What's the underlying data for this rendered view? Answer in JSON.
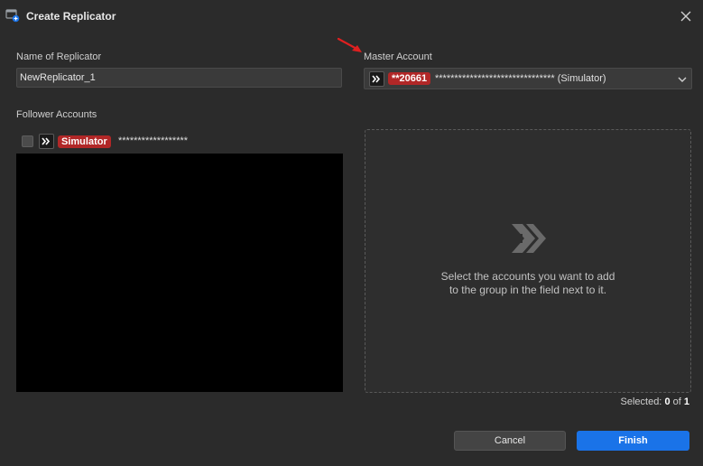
{
  "dialog": {
    "title": "Create Replicator",
    "close_icon": "close-icon",
    "app_icon": "replicator-app-icon"
  },
  "name_field": {
    "label": "Name of Replicator",
    "value": "NewReplicator_1"
  },
  "master_account": {
    "label": "Master Account",
    "account_id": "**20661",
    "masked": "******************************* (Simulator)",
    "dropdown_icon": "chevron-down-icon"
  },
  "followers": {
    "label": "Follower Accounts",
    "items": [
      {
        "badge": "Simulator",
        "masked": "******************",
        "checked": false
      }
    ]
  },
  "dropzone": {
    "icon": "double-chevron-right-icon",
    "line1": "Select the accounts you want to add",
    "line2": "to the group in the field next to it."
  },
  "selection": {
    "prefix": "Selected:",
    "count": "0",
    "of": "of",
    "total": "1"
  },
  "buttons": {
    "cancel": "Cancel",
    "finish": "Finish"
  },
  "colors": {
    "background": "#2b2b2b",
    "badge": "#b12727",
    "accent": "#1a73e8",
    "arrow": "#e02020"
  }
}
